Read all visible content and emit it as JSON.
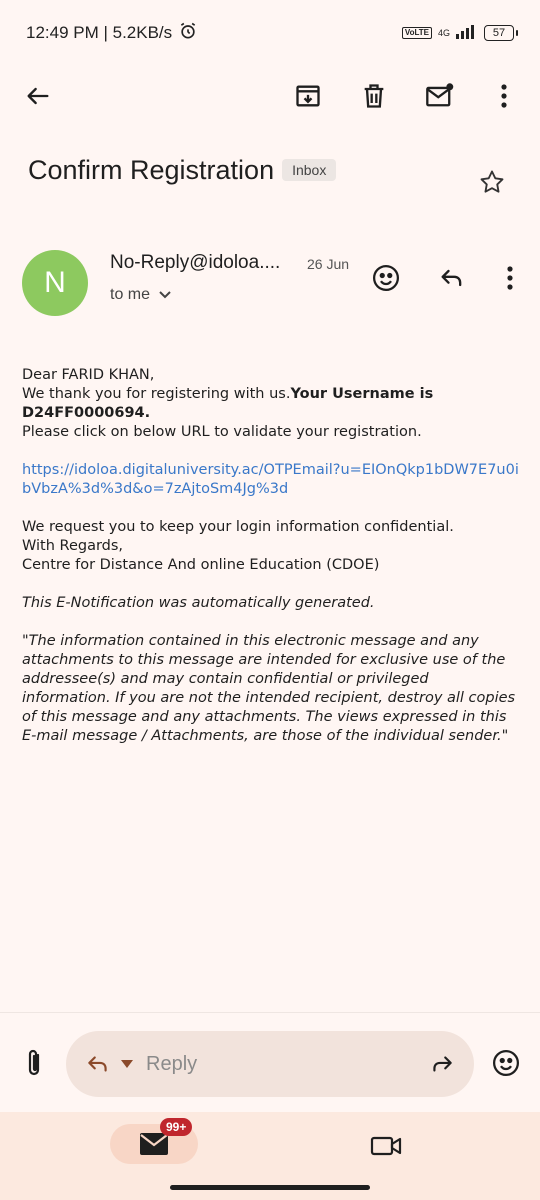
{
  "status_bar": {
    "time_speed": "12:49 PM | 5.2KB/s",
    "volte": "VoLTE",
    "network": "4G",
    "battery": "57"
  },
  "email": {
    "subject": "Confirm Registration",
    "label": "Inbox",
    "sender_initial": "N",
    "sender_name": "No-Reply@idoloa....",
    "date": "26 Jun",
    "recipient": "to me",
    "body": {
      "greeting": "Dear FARID KHAN,",
      "thanks": "We thank you for registering with us.",
      "username_label": "Your Username is",
      "username": "D24FF0000694.",
      "instruction": "Please click on below URL to validate your registration.",
      "link": "https://idoloa.digitaluniversity.ac/OTPEmail?u=EIOnQkp1bDW7E7u0ibVbzA%3d%3d&o=7zAjtoSm4Jg%3d",
      "request": "We request you to keep your login information confidential.",
      "regards": "With Regards,",
      "org": "Centre for Distance And online Education (CDOE)",
      "notification": "This E-Notification was automatically generated.",
      "disclaimer": "\"The information contained in this electronic message and any attachments to this message are intended for exclusive use of the addressee(s) and may contain confidential or privileged information. If you are not the intended recipient, destroy all copies of this message and any attachments. The views expressed in this E-mail message / Attachments, are those of the individual sender.\""
    }
  },
  "reply_bar": {
    "placeholder": "Reply"
  },
  "bottom_nav": {
    "mail_badge": "99+"
  },
  "colors": {
    "background": "#FFF6F3",
    "avatar": "#8DC95F",
    "link": "#3A78C9",
    "badge": "#C0262D"
  }
}
